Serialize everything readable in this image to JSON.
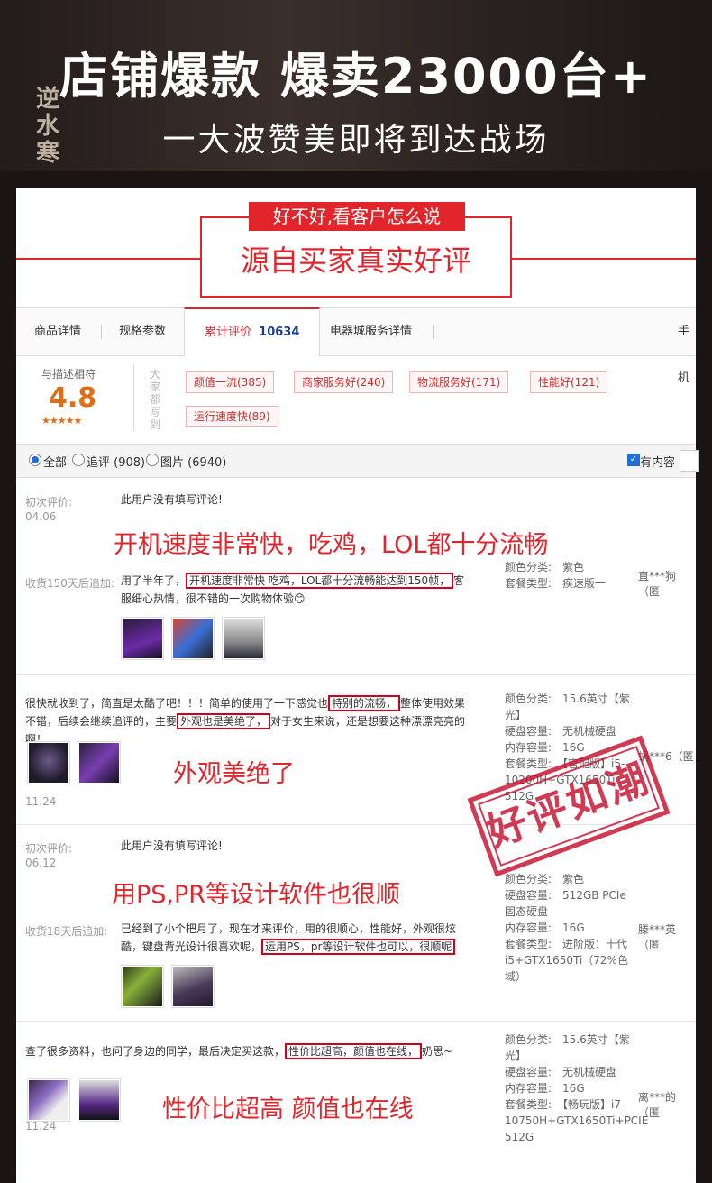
{
  "hero": {
    "title": "店铺爆款  爆卖23000台+",
    "subtitle": "一大波赞美即将到达战场",
    "logo_text": "逆水寒"
  },
  "banner": {
    "top_text": "好不好,看客户怎么说",
    "main_text": "源自买家真实好评"
  },
  "tabs": [
    {
      "label": "商品详情"
    },
    {
      "label": "规格参数"
    },
    {
      "label": "累计评价",
      "count": "10634"
    },
    {
      "label": "电器城服务详情"
    },
    {
      "label": "手机"
    }
  ],
  "rating": {
    "label": "与描述相符",
    "score": "4.8",
    "stars": "★★★★★",
    "side_label": "大家都写到"
  },
  "tags": [
    "颜值一流(385)",
    "商家服务好(240)",
    "物流服务好(171)",
    "性能好(121)",
    "运行速度快(89)"
  ],
  "filter": {
    "all": "全部",
    "follow": "追评 (908)",
    "pics": "图片 (6940)",
    "has_content": "有内容"
  },
  "stamp": "好评如潮",
  "reviews": [
    {
      "first_label": "初次评价:",
      "date": "04.06",
      "first_text": "此用户没有填写评论!",
      "headline": "开机速度非常快，吃鸡，LOL都十分流畅",
      "follow_label": "收货150天后追加:",
      "follow_pre": "用了半年了，",
      "follow_hl": "开机速度非常快 吃鸡，LOL都十分流畅能达到150帧，",
      "follow_post": "客服细心热情，很不错的一次购物体验😊",
      "spec_lines": [
        "颜色分类:　紫色",
        "套餐类型:　疾速版一"
      ],
      "user": "直***狗（匿"
    },
    {
      "text_pre": "很快就收到了，简直是太酷了吧！！！简单的使用了一下感觉也",
      "text_hl1": "特别的流畅，",
      "text_mid": "整体使用效果不错，后续会继续追评的，主要",
      "text_hl2": "外观也是美绝了，",
      "text_post": "对于女生来说，还是想要这种漂漂亮亮的啊！",
      "headline": "外观美绝了",
      "date": "11.24",
      "spec_lines": [
        "颜色分类:　15.6英寸【紫",
        "光】",
        "硬盘容量:　无机械硬盘",
        "内存容量:　16G",
        "套餐类型:　【官配版】i5-",
        "10200H+GTX1650Ti",
        "512G"
      ],
      "user": "蜗***6（匿"
    },
    {
      "first_label": "初次评价:",
      "date": "06.12",
      "first_text": "此用户没有填写评论!",
      "headline": "用PS,PR等设计软件也很顺",
      "follow_label": "收货18天后追加:",
      "follow_pre": "已经到了小个把月了，现在才来评价，用的很顺心，性能好，外观很炫酷，键盘背光设计很喜欢呢，",
      "follow_hl": "运用PS，pr等设计软件也可以，很顺呢",
      "follow_post": "",
      "spec_lines": [
        "颜色分类:　紫色",
        "硬盘容量:　512GB PCIe",
        "固态硬盘",
        "内存容量:　16G",
        "套餐类型:　进阶版：十代",
        "i5+GTX1650Ti（72%色",
        "域）"
      ],
      "user": "滕***英（匿"
    },
    {
      "text_pre": "查了很多资料，也问了身边的同学，最后决定买这款，",
      "text_hl1": "性价比超高，颜值也在线，",
      "text_post": "奶思~",
      "headline": "性价比超高 颜值也在线",
      "date": "11.24",
      "spec_lines": [
        "颜色分类:　15.6英寸【紫",
        "光】",
        "硬盘容量:　无机械硬盘",
        "内存容量:　16G",
        "套餐类型:　【畅玩版】i7-",
        "10750H+GTX1650Ti+PCIE",
        "512G"
      ],
      "user": "离***的（匿"
    }
  ]
}
